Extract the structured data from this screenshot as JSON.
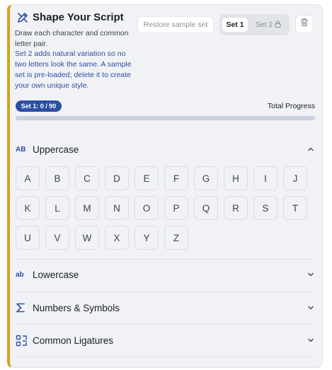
{
  "header": {
    "title": "Shape Your Script",
    "description": "Draw each character and common letter pair.",
    "note": "Set 2 adds natural variation so no two letters look the same. A sample set is pre-loaded; delete it to create your own unique style.",
    "restore_label": "Restore sample set",
    "set1_label": "Set 1",
    "set2_label": "Set 2",
    "icon": "pen-tool-icon",
    "lock_icon": "lock-icon",
    "delete_icon": "trash-icon"
  },
  "progress": {
    "badge": "Set 1: 0 / 90",
    "label": "Total Progress",
    "completed": 0,
    "total": 90,
    "fill_color": "#2c4fa3"
  },
  "sections": {
    "uppercase": {
      "label": "Uppercase",
      "icon": "AB",
      "expanded": true
    },
    "lowercase": {
      "label": "Lowercase",
      "icon": "ab",
      "expanded": false
    },
    "numbers": {
      "label": "Numbers & Symbols",
      "icon": "sigma-icon",
      "expanded": false
    },
    "ligatures": {
      "label": "Common Ligatures",
      "icon": "ligature-icon",
      "expanded": false
    }
  },
  "uppercase_letters": [
    "A",
    "B",
    "C",
    "D",
    "E",
    "F",
    "G",
    "H",
    "I",
    "J",
    "K",
    "L",
    "M",
    "N",
    "O",
    "P",
    "Q",
    "R",
    "S",
    "T",
    "U",
    "V",
    "W",
    "X",
    "Y",
    "Z"
  ],
  "colors": {
    "accent": "#2c4fa3",
    "left_border": "#d4a21a"
  }
}
